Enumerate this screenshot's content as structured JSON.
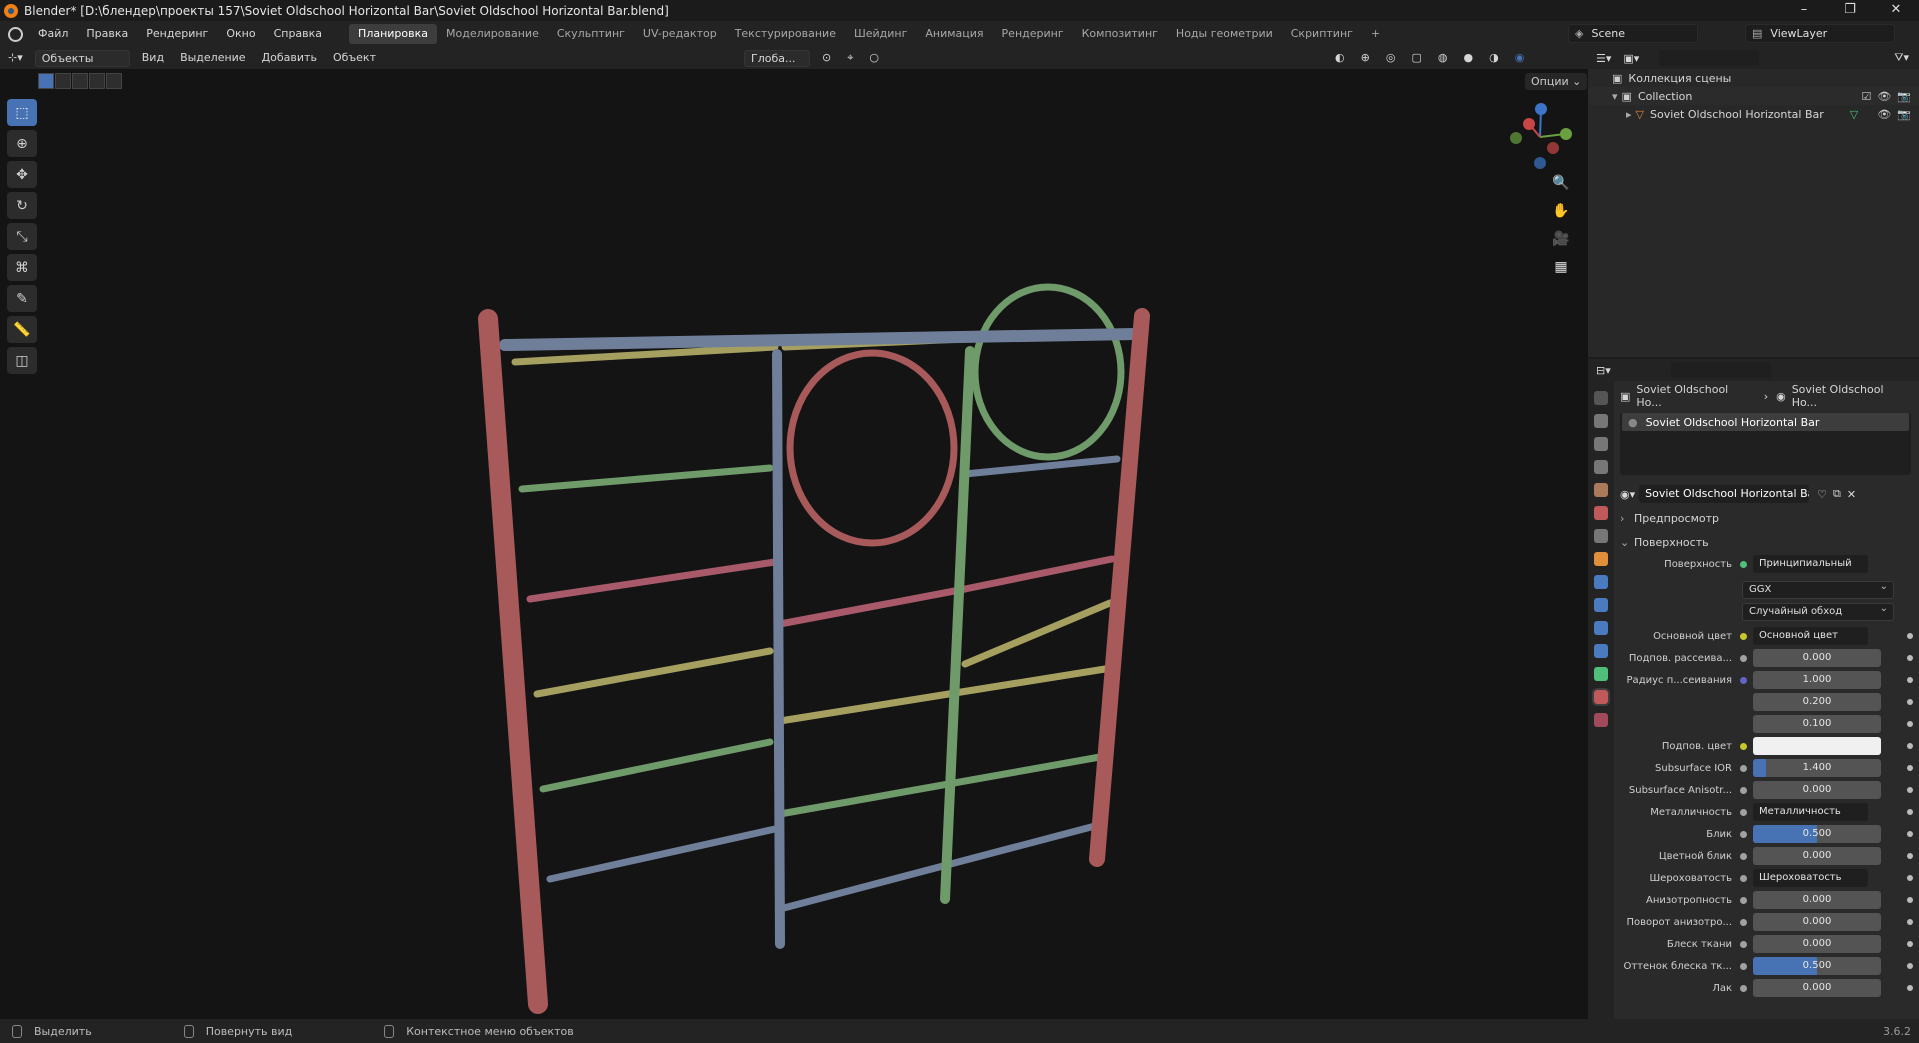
{
  "window": {
    "title": "Blender* [D:\\блендер\\проекты 157\\Soviet Oldschool Horizontal Bar\\Soviet Oldschool Horizontal Bar.blend]"
  },
  "menu": [
    "Файл",
    "Правка",
    "Рендеринг",
    "Окно",
    "Справка"
  ],
  "workspaces": [
    "Планировка",
    "Моделирование",
    "Скульптинг",
    "UV-редактор",
    "Текстурирование",
    "Шейдинг",
    "Анимация",
    "Рендеринг",
    "Композитинг",
    "Ноды геометрии",
    "Скриптинг"
  ],
  "active_workspace": "Планировка",
  "scene": {
    "name": "Scene",
    "view_layer": "ViewLayer"
  },
  "viewport_header": {
    "mode": "Объекты",
    "menus": [
      "Вид",
      "Выделение",
      "Добавить",
      "Объект"
    ],
    "orientation": "Глоба...",
    "options": "Опции"
  },
  "outliner": {
    "root": "Коллекция сцены",
    "collection": "Collection",
    "object": "Soviet Oldschool Horizontal Bar"
  },
  "properties": {
    "breadcrumb": [
      "Soviet Oldschool Ho...",
      "Soviet Oldschool Ho..."
    ],
    "slot": "Soviet Oldschool Horizontal Bar",
    "material": "Soviet Oldschool Horizontal Bar",
    "panels": {
      "preview": "Предпросмотр",
      "surface": "Поверхность"
    },
    "surface_label": "Поверхность",
    "surface_value": "Принципиальный BSDF",
    "distribution": "GGX",
    "subsurface_method": "Случайный обход",
    "rows": [
      {
        "label": "Основной цвет",
        "value": "Основной цвет",
        "kind": "link",
        "sock": "#c7c729"
      },
      {
        "label": "Подпов. рассеива...",
        "value": "0.000",
        "kind": "num",
        "sock": "#a1a1a1"
      },
      {
        "label": "Радиус п...сеивания",
        "value": "1.000",
        "kind": "num",
        "sock": "#6363c7"
      },
      {
        "label": "",
        "value": "0.200",
        "kind": "num",
        "sock": ""
      },
      {
        "label": "",
        "value": "0.100",
        "kind": "num",
        "sock": ""
      },
      {
        "label": "Подпов. цвет",
        "value": "",
        "kind": "white",
        "sock": "#c7c729"
      },
      {
        "label": "Subsurface IOR",
        "value": "1.400",
        "kind": "num",
        "sock": "#a1a1a1",
        "fill": 0.1
      },
      {
        "label": "Subsurface Anisotr...",
        "value": "0.000",
        "kind": "num",
        "sock": "#a1a1a1"
      },
      {
        "label": "Металличность",
        "value": "Металличность",
        "kind": "link",
        "sock": "#a1a1a1"
      },
      {
        "label": "Блик",
        "value": "0.500",
        "kind": "num",
        "sock": "#a1a1a1",
        "fill": 0.5
      },
      {
        "label": "Цветной блик",
        "value": "0.000",
        "kind": "num",
        "sock": "#a1a1a1"
      },
      {
        "label": "Шероховатость",
        "value": "Шероховатость",
        "kind": "link",
        "sock": "#a1a1a1"
      },
      {
        "label": "Анизотропность",
        "value": "0.000",
        "kind": "num",
        "sock": "#a1a1a1"
      },
      {
        "label": "Поворот анизотро...",
        "value": "0.000",
        "kind": "num",
        "sock": "#a1a1a1"
      },
      {
        "label": "Блеск ткани",
        "value": "0.000",
        "kind": "num",
        "sock": "#a1a1a1"
      },
      {
        "label": "Оттенок блеска тк...",
        "value": "0.500",
        "kind": "num",
        "sock": "#a1a1a1",
        "fill": 0.5
      },
      {
        "label": "Лак",
        "value": "0.000",
        "kind": "num",
        "sock": "#a1a1a1"
      }
    ]
  },
  "statusbar": {
    "items": [
      "Выделить",
      "Повернуть вид",
      "Контекстное меню объектов"
    ],
    "version": "3.6.2"
  },
  "colors": {
    "accent": "#4772b3",
    "rail_red": "#a85a5a",
    "rail_blue": "#6f7f9a",
    "rung_green": "#6f9a6a",
    "rung_yellow": "#a6a060"
  }
}
